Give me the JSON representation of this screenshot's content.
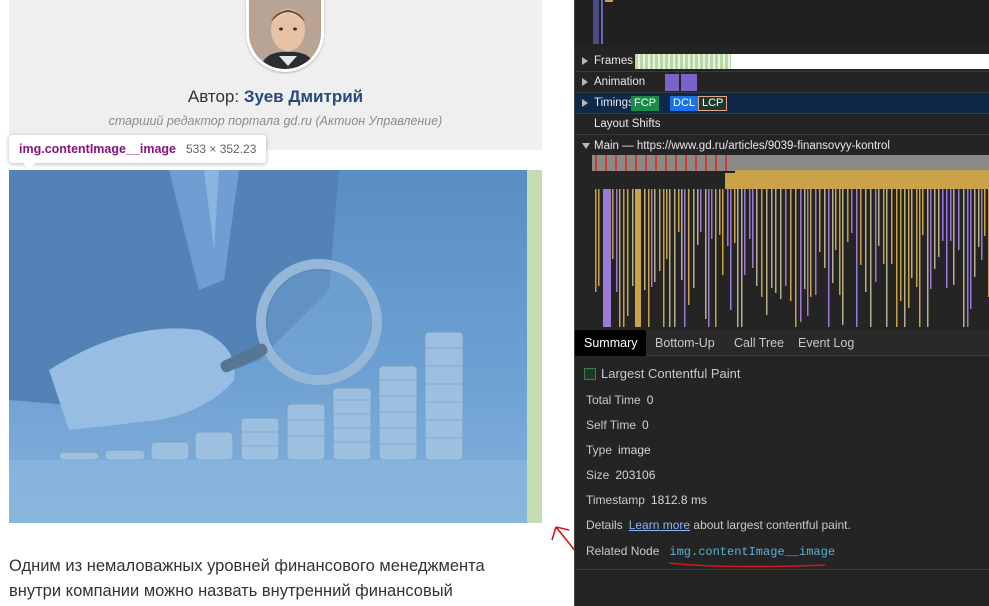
{
  "author": {
    "prefix": "Автор:",
    "name": "Зуев Дмитрий",
    "role": "старший редактор портала gd.ru (Актион Управление)"
  },
  "tooltip": {
    "selector": "img.contentImage__image",
    "dimensions": "533 × 352.23"
  },
  "article": {
    "line1": "Одним из немаловажных уровней финансового менеджмента",
    "line2": "внутри компании можно назвать внутренний финансовый"
  },
  "devtools": {
    "tracks": {
      "frames": "Frames",
      "animation": "Animation",
      "timings": "Timings",
      "layout_shifts": "Layout Shifts",
      "main": "Main — https://www.gd.ru/articles/9039-finansovyy-kontrol"
    },
    "timing_marks": {
      "fcp": "FCP",
      "dcl": "DCL",
      "lcp": "LCP"
    },
    "tabs": {
      "summary": "Summary",
      "bottom_up": "Bottom-Up",
      "call_tree": "Call Tree",
      "event_log": "Event Log"
    },
    "summary": {
      "title": "Largest Contentful Paint",
      "total_time_label": "Total Time",
      "total_time_value": "0",
      "self_time_label": "Self Time",
      "self_time_value": "0",
      "type_label": "Type",
      "type_value": "image",
      "size_label": "Size",
      "size_value": "203106",
      "timestamp_label": "Timestamp",
      "timestamp_value": "1812.8 ms",
      "details_label": "Details",
      "learn_more": "Learn more",
      "details_rest": "about largest contentful paint.",
      "related_node_label": "Related Node",
      "related_node_value": "img.contentImage__image"
    },
    "colors": {
      "fcp": "#1a8a4a",
      "dcl": "#1a73e8",
      "lcp": "#3c7a4a",
      "scripting": "#c9a24a",
      "rendering": "#9b7ad8",
      "annotation": "#d01818"
    }
  }
}
